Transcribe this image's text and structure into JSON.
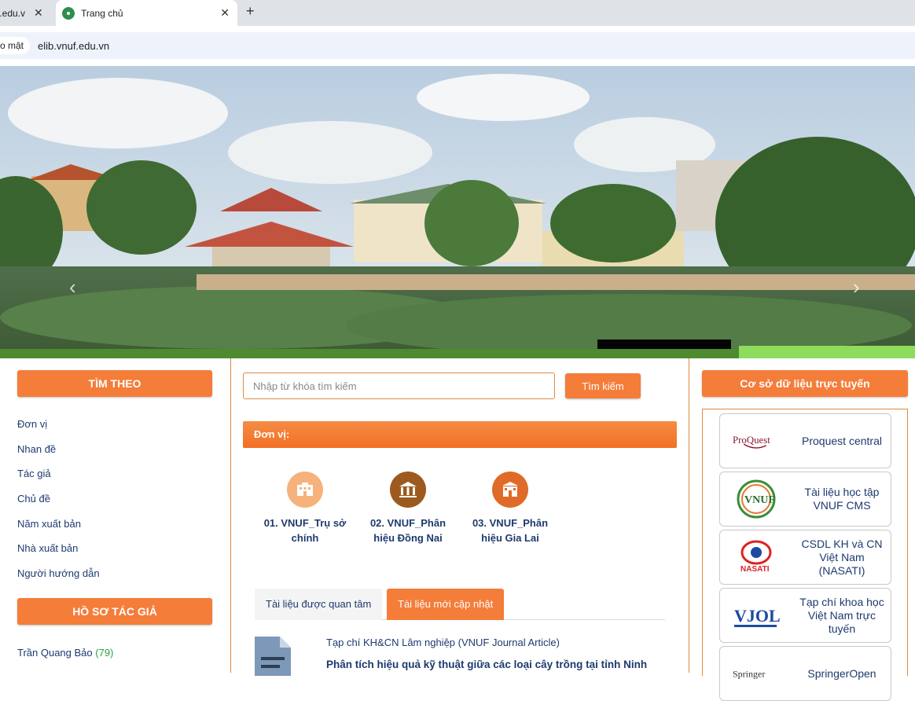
{
  "browser": {
    "tabs": [
      {
        "title": "f.edu.v",
        "active": false
      },
      {
        "title": "Trang chủ",
        "active": true
      }
    ],
    "close_glyph": "✕",
    "new_tab_glyph": "+",
    "security_chip": "o mật",
    "url": "elib.vnuf.edu.vn"
  },
  "banner": {
    "prev_glyph": "‹",
    "next_glyph": "›"
  },
  "left": {
    "browse_header": "TÌM THEO",
    "browse_items": [
      "Đơn vị",
      "Nhan đề",
      "Tác giả",
      "Chủ đề",
      "Năm xuất bản",
      "Nhà xuất bản",
      "Người hướng dẫn"
    ],
    "author_header": "HỒ SƠ TÁC GIẢ",
    "authors": [
      {
        "name": "Trần Quang Bảo",
        "count": "(79)"
      }
    ]
  },
  "center": {
    "search_placeholder": "Nhập từ khóa tìm kiếm",
    "search_button": "Tìm kiếm",
    "units_header": "Đơn vị:",
    "units": [
      {
        "label": "01. VNUF_Trụ sở chính",
        "color": "#f6b27a"
      },
      {
        "label": "02. VNUF_Phân hiệu Đồng Nai",
        "color": "#9c5a1e"
      },
      {
        "label": "03. VNUF_Phân hiệu Gia Lai",
        "color": "#e06a28"
      }
    ],
    "tabs": [
      "Tài liệu được quan tâm",
      "Tài liệu mới cập nhật"
    ],
    "active_tab": 1,
    "doc_source": "Tạp chí KH&CN Lâm nghiệp (VNUF Journal Article)",
    "doc_title": "Phân tích hiệu quả kỹ thuật giữa các loại cây trồng tại tỉnh Ninh"
  },
  "right": {
    "header": "Cơ sở dữ liệu trực tuyến",
    "databases": [
      {
        "name": "Proquest central",
        "logo": "ProQuest"
      },
      {
        "name": "Tài liệu học tập VNUF CMS",
        "logo": "VNUF"
      },
      {
        "name": "CSDL KH và CN Việt Nam (NASATI)",
        "logo": "NASATI"
      },
      {
        "name": "Tạp chí khoa học Việt Nam trực tuyến",
        "logo": "VJOL"
      },
      {
        "name": "SpringerOpen",
        "logo": "Springer"
      }
    ]
  },
  "colors": {
    "accent": "#f47d3a",
    "text": "#1d3a6e",
    "count": "#2e9e3e"
  }
}
